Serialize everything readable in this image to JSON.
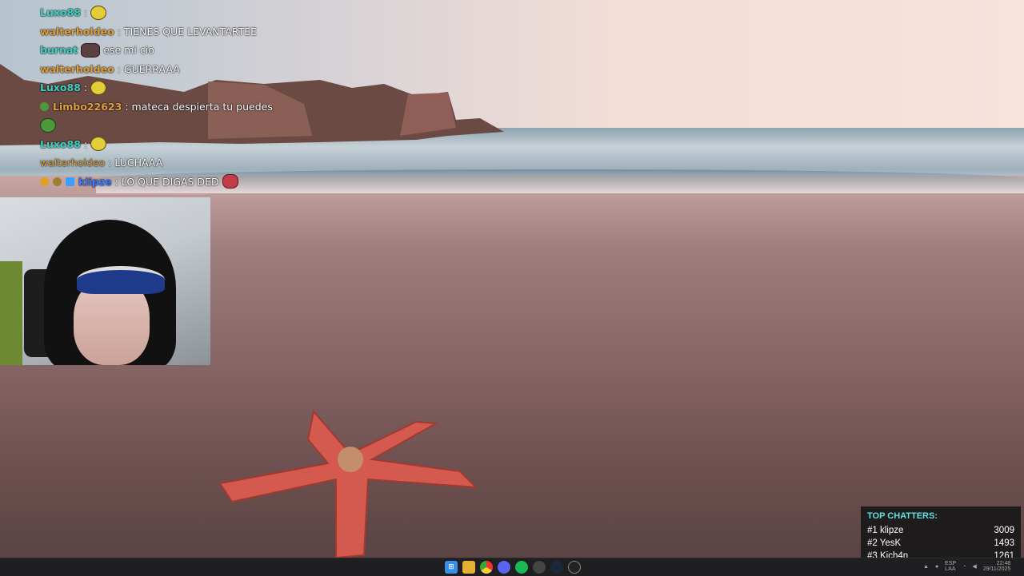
{
  "chat": {
    "messages": [
      {
        "user": "Luxo88",
        "user_color": "#3fd1c4",
        "text": "",
        "emote": "yellow-face-emote"
      },
      {
        "user": "walterholdeo",
        "user_color": "#e0a040",
        "text": "TIENES QUE LEVANTARTEE",
        "emote": ""
      },
      {
        "user": "burnat",
        "user_color": "#3fd1c4",
        "text": "ese mi cio",
        "emote": "dark-emote"
      },
      {
        "user": "walterholdeo",
        "user_color": "#e0a040",
        "text": "GUERRAAA",
        "emote": ""
      },
      {
        "user": "Luxo88",
        "user_color": "#3fd1c4",
        "text": "",
        "emote": "yellow-face-emote"
      },
      {
        "user": "Limbo22623",
        "user_color": "#e0a040",
        "text": "mateca despierta tu puedes",
        "emote": ""
      },
      {
        "user": "",
        "user_color": "#3fd1c4",
        "text": "",
        "emote": "pepe-emote"
      },
      {
        "user": "Luxo88",
        "user_color": "#3fd1c4",
        "text": "",
        "emote": "yellow-face-emote"
      },
      {
        "user": "walterholdeo",
        "user_color": "#e0a040",
        "text": "LUCHAAA",
        "emote": ""
      },
      {
        "user": "klipze",
        "user_color": "#3a7bff",
        "text": "LO QUE DIGAS DED",
        "emote": "red-emote"
      }
    ]
  },
  "top_chatters": {
    "title": "TOP CHATTERS:",
    "entries": [
      {
        "rank": "#1",
        "name": "klipze",
        "count": "3009"
      },
      {
        "rank": "#2",
        "name": "YesK",
        "count": "1493"
      },
      {
        "rank": "#3",
        "name": "Kich4n",
        "count": "1261"
      }
    ]
  },
  "taskbar": {
    "icons": [
      "windows-start-icon",
      "file-explorer-icon",
      "chrome-icon",
      "discord-icon",
      "spotify-icon",
      "chatgpt-icon",
      "steam-icon",
      "obs-icon"
    ],
    "tray": {
      "lang": "ESP",
      "lang_sub": "LAA",
      "time": "22:48",
      "date": "29/11/2025"
    }
  },
  "colors": {
    "accent": "#5ee3e0",
    "chatter_bg": "#141416"
  }
}
